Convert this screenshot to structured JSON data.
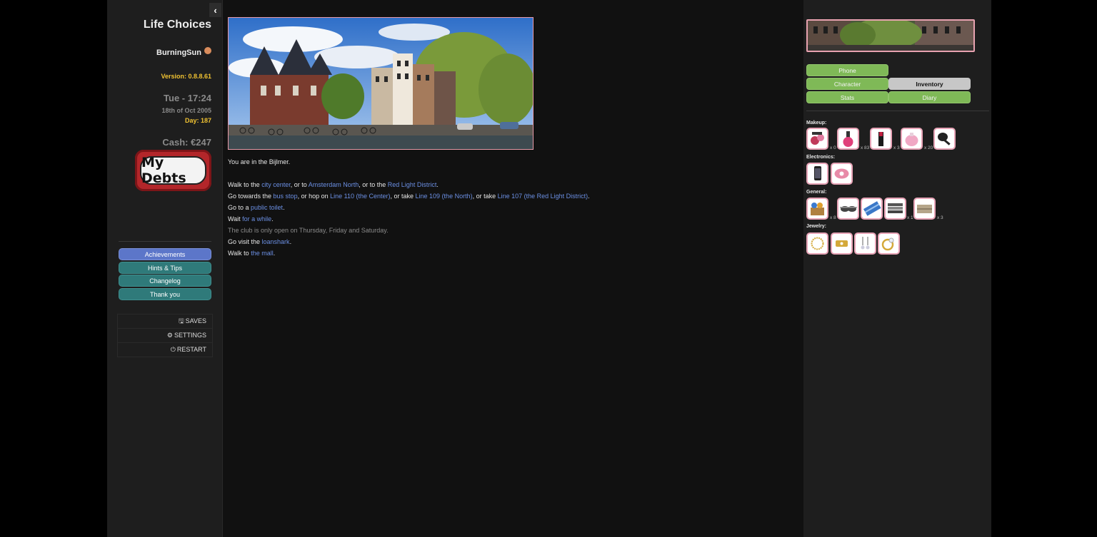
{
  "sidebar": {
    "title": "Life Choices",
    "username": "BurningSun",
    "version": "Version: 0.8.8.61",
    "time": "Tue - 17:24",
    "date": "18th of Oct 2005",
    "day": "Day: 187",
    "cash": "Cash: €247",
    "debts_label": "My Debts",
    "buttons": [
      {
        "label": "Achievements"
      },
      {
        "label": "Hints & Tips"
      },
      {
        "label": "Changelog"
      },
      {
        "label": "Thank you"
      }
    ],
    "menu": [
      {
        "label": "SAVES",
        "icon": "save-icon"
      },
      {
        "label": "SETTINGS",
        "icon": "gear-icon"
      },
      {
        "label": "RESTART",
        "icon": "power-icon"
      }
    ]
  },
  "passage": {
    "location": "You are in the Bijlmer.",
    "l1": {
      "a": "Walk to the ",
      "b": "city center",
      "c": ", or to ",
      "d": "Amsterdam North",
      "e": ", or to the ",
      "f": "Red Light District",
      "g": "."
    },
    "l2": {
      "a": "Go towards the ",
      "b": "bus stop",
      "c": ", or hop on ",
      "d": "Line 110 (the Center)",
      "e": ", or take ",
      "f": "Line 109 (the North)",
      "g": ", or take ",
      "h": "Line 107 (the Red Light District)",
      "i": "."
    },
    "l3": {
      "a": "Go to a ",
      "b": "public toilet",
      "c": "."
    },
    "l4": {
      "a": "Wait ",
      "b": "for a while",
      "c": "."
    },
    "l5": "The club is only open on Thursday, Friday and Saturday.",
    "l6": {
      "a": "Go visit the ",
      "b": "loanshark",
      "c": "."
    },
    "l7": {
      "a": "Walk to ",
      "b": "the mall",
      "c": "."
    }
  },
  "right": {
    "tabs": {
      "phone": "Phone",
      "character": "Character",
      "inventory": "Inventory",
      "stats": "Stats",
      "diary": "Diary"
    },
    "categories": {
      "makeup": "Makeup:",
      "electronics": "Electronics:",
      "general": "General:",
      "jewelry": "Jewelry:"
    },
    "counts": {
      "makeup_1": "x 0",
      "makeup_2": "x 83",
      "makeup_3": "x 3",
      "makeup_4": "x 20",
      "general_1": "x 8",
      "general_4": "x 1",
      "general_5": "x 3"
    }
  },
  "colors": {
    "link": "#6b8fe3",
    "gold": "#f0c232",
    "green_tab": "#7fb957",
    "teal_button": "#2f7a7a",
    "blue_button": "#5c76c9",
    "pink_border": "#e7a3b6",
    "debt_red": "#b3262a"
  }
}
